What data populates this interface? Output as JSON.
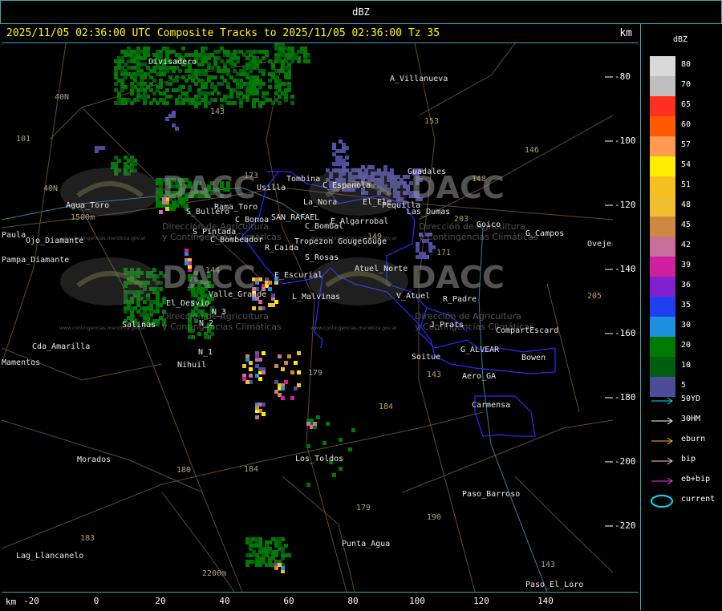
{
  "top_bar": {
    "label": "dBZ"
  },
  "title": "2025/11/05 02:36:00 UTC Composite Tracks to 2025/11/05 02:36:00 Tz 35",
  "km_label": "km",
  "colors": {
    "frame": "#3fa7a7",
    "title": "#ffff00",
    "boundary": "#2a2aff",
    "roads": "#6b5a3a",
    "labels": "#e8e8e8"
  },
  "legend": {
    "title": "dBZ",
    "scale": [
      {
        "value": "80",
        "color": "#d9d9d9"
      },
      {
        "value": "70",
        "color": "#bfbfbf"
      },
      {
        "value": "65",
        "color": "#ff3020"
      },
      {
        "value": "60",
        "color": "#ff5a00"
      },
      {
        "value": "57",
        "color": "#ff9a50"
      },
      {
        "value": "54",
        "color": "#ffee00"
      },
      {
        "value": "51",
        "color": "#f5c020"
      },
      {
        "value": "48",
        "color": "#f0c030"
      },
      {
        "value": "45",
        "color": "#d08840"
      },
      {
        "value": "42",
        "color": "#c8709a"
      },
      {
        "value": "39",
        "color": "#d020a0"
      },
      {
        "value": "36",
        "color": "#8020d0"
      },
      {
        "value": "35",
        "color": "#2040f0"
      },
      {
        "value": "30",
        "color": "#1f8fe0"
      },
      {
        "value": "20",
        "color": "#007a00"
      },
      {
        "value": "10",
        "color": "#005e10"
      },
      {
        "value": "5",
        "color": "#4c4c9a"
      }
    ],
    "tracks": [
      {
        "label": "50YD",
        "color": "#00e0ff",
        "icon": "arrow-right-icon"
      },
      {
        "label": "30HM",
        "color": "#ffffff",
        "icon": "arrow-right-icon"
      },
      {
        "label": "eburn",
        "color": "#ffb030",
        "icon": "arrow-right-icon"
      },
      {
        "label": "bip",
        "color": "#ffc8c8",
        "icon": "arrow-right-icon"
      },
      {
        "label": "eb+bip",
        "color": "#e040e0",
        "icon": "arrow-right-icon"
      },
      {
        "label": "current",
        "color": "#00e0ff",
        "icon": "ellipse-icon"
      }
    ]
  },
  "x_axis": {
    "unit": "km",
    "ticks": [
      "-20",
      "0",
      "20",
      "40",
      "60",
      "80",
      "100",
      "120",
      "140"
    ]
  },
  "y_axis": {
    "ticks": [
      "-80",
      "-100",
      "-120",
      "-140",
      "-160",
      "-180",
      "-200",
      "-220"
    ]
  },
  "places": [
    "Divisadero",
    "A_Villanueva",
    "Guadales",
    "Tombina",
    "Usilla",
    "C_Espanola",
    "La_Nora",
    "El_Ele",
    "Pequilla",
    "Las_Dumas",
    "Rama_Toro",
    "Agua_Toro",
    "S_Pintada",
    "S_Bullero",
    "C_Bonoa",
    "SAN_RAFAEL",
    "C_Bombal",
    "E_Algarrobal",
    "Gouge",
    "Goico",
    "G_Campos",
    "Ovejeros",
    "Pampa_Diamante",
    "Ojo_Diamante",
    "C_Bombeador",
    "R_Caida",
    "S_Rosas",
    "Tropezon Gouge",
    "E_Escurial",
    "Atuel_Norte",
    "El_Desvio",
    "Valle_Grande",
    "L_Malvinas",
    "V_Atuel",
    "R_Padre",
    "Salinas",
    "N_2",
    "N_3",
    "J_Prats",
    "CompartEscard",
    "Cda_Amarilla",
    "N_1",
    "G_ALVEAR",
    "Bowen",
    "Nihuil",
    "Soitue",
    "Aero_GA",
    "Carmensa",
    "Morados",
    "Los_Toldos",
    "Paso_Barroso",
    "Punta_Agua",
    "Lag_Llancanelo",
    "Paso_El_Loro",
    "Mamentos",
    "Paula"
  ],
  "route_numbers": [
    "143",
    "153",
    "146",
    "148",
    "40N",
    "101",
    "173",
    "144",
    "171",
    "149",
    "203",
    "205",
    "179",
    "184",
    "180",
    "184",
    "183",
    "179",
    "190",
    "143",
    "40N",
    "143"
  ],
  "elevations": [
    "1500m",
    "2200m"
  ],
  "watermarks": [
    {
      "brand": "DACC",
      "line1": "Dirección de Agricultura",
      "line2": "y Contingencias Climáticas",
      "url": "www.contingencias.mendoza.gov.ar"
    },
    {
      "brand": "DACC",
      "line1": "Dirección de Agricultura",
      "line2": "y Contingencias Climáticas",
      "url": "www.contingencias.mendoza.gov.ar"
    },
    {
      "brand": "DACC",
      "line1": "Dirección de Agricultura",
      "line2": "y Contingencias Climáticas",
      "url": "www.contingencias.mendoza.gov.ar"
    },
    {
      "brand": "DACC",
      "line1": "Dirección de Agricultura",
      "line2": "y Contingencias Climáticas",
      "url": "www.contingencias.mendoza.gov.ar"
    }
  ]
}
